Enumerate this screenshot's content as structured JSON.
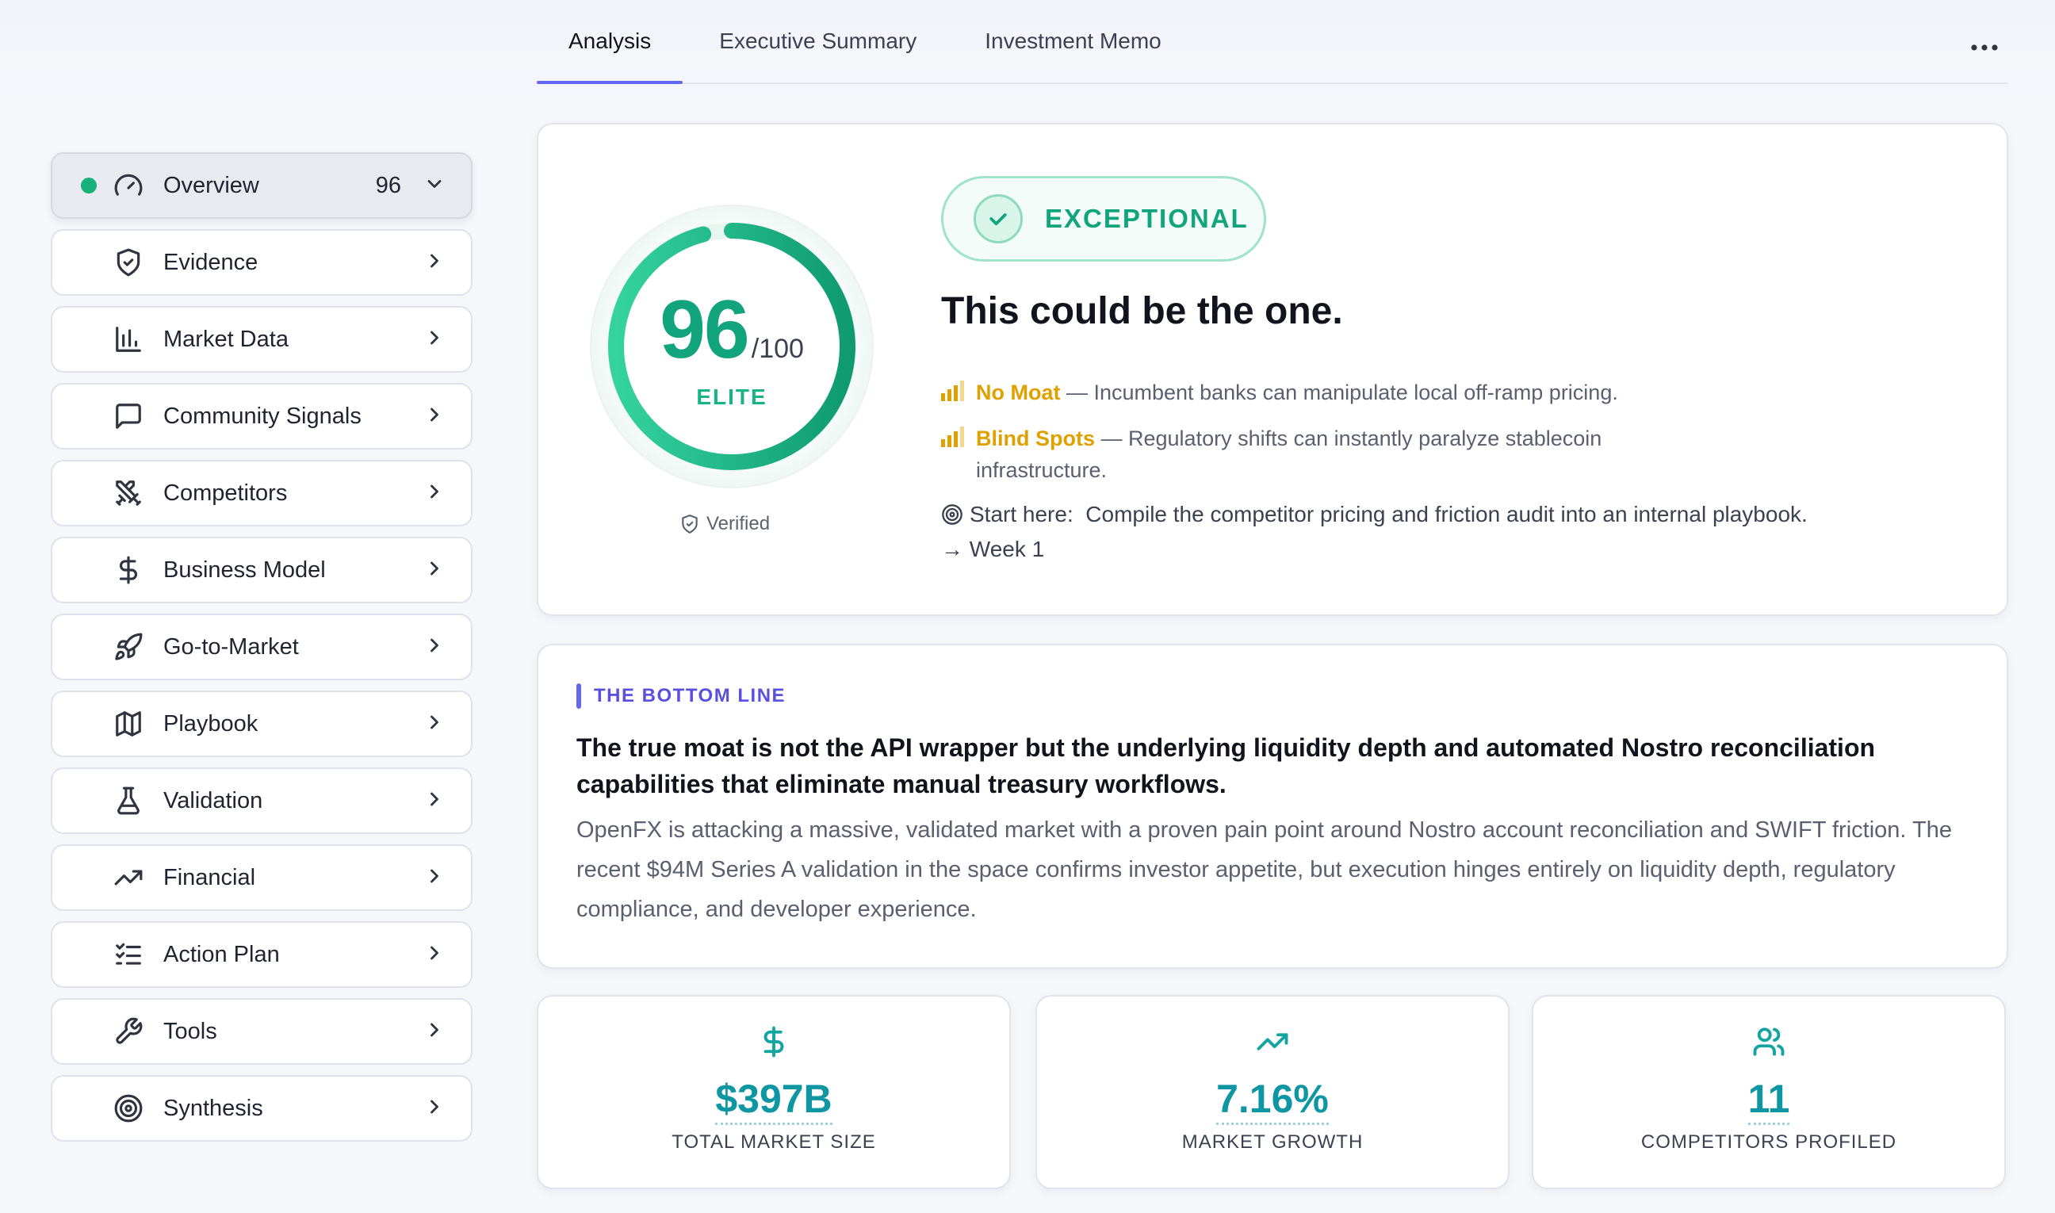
{
  "tabs": [
    {
      "label": "Analysis",
      "active": true
    },
    {
      "label": "Executive Summary",
      "active": false
    },
    {
      "label": "Investment Memo",
      "active": false
    }
  ],
  "sidebar": {
    "items": [
      {
        "label": "Overview",
        "icon": "gauge-icon",
        "count": "96",
        "active": true
      },
      {
        "label": "Evidence",
        "icon": "shield-check-icon"
      },
      {
        "label": "Market Data",
        "icon": "bar-chart-icon"
      },
      {
        "label": "Community Signals",
        "icon": "message-square-icon"
      },
      {
        "label": "Competitors",
        "icon": "swords-icon"
      },
      {
        "label": "Business Model",
        "icon": "dollar-icon"
      },
      {
        "label": "Go-to-Market",
        "icon": "rocket-icon"
      },
      {
        "label": "Playbook",
        "icon": "map-icon"
      },
      {
        "label": "Validation",
        "icon": "flask-icon"
      },
      {
        "label": "Financial",
        "icon": "trending-up-icon"
      },
      {
        "label": "Action Plan",
        "icon": "list-checks-icon"
      },
      {
        "label": "Tools",
        "icon": "wrench-icon"
      },
      {
        "label": "Synthesis",
        "icon": "target-icon"
      }
    ]
  },
  "score": {
    "value": 96,
    "display": "96",
    "denominator": "/100",
    "tier": "ELITE",
    "verified": "Verified"
  },
  "verdict": {
    "badge": "EXCEPTIONAL",
    "headline": "This could be the one."
  },
  "risks": [
    {
      "name": "No Moat",
      "text": " — Incumbent banks can manipulate local off-ramp pricing.",
      "cont": ""
    },
    {
      "name": "Blind Spots",
      "text": " — Regulatory shifts can instantly paralyze stablecoin",
      "cont": "infrastructure."
    }
  ],
  "start_here": {
    "label": "Start here:",
    "text": "Compile the competitor pricing and friction audit into an internal playbook.",
    "when": "→ Week 1"
  },
  "bottom_line": {
    "label": "THE BOTTOM LINE",
    "headline": "The true moat is not the API wrapper but the underlying liquidity depth and automated Nostro reconciliation capabilities that eliminate manual treasury workflows.",
    "body": "OpenFX is attacking a massive, validated market with a proven pain point around Nostro account reconciliation and SWIFT friction. The recent $94M Series A validation in the space confirms investor appetite, but execution hinges entirely on liquidity depth, regulatory compliance, and developer experience."
  },
  "stats": [
    {
      "icon": "dollar-icon",
      "value": "$397B",
      "label": "TOTAL MARKET SIZE"
    },
    {
      "icon": "trending-up-icon",
      "value": "7.16%",
      "label": "MARKET GROWTH"
    },
    {
      "icon": "users-icon",
      "value": "11",
      "label": "COMPETITORS PROFILED"
    }
  ],
  "colors": {
    "accent": "#6366f1",
    "score_green": "#12a47c",
    "warning": "#e0a100",
    "stat_teal": "#0e96a3"
  }
}
